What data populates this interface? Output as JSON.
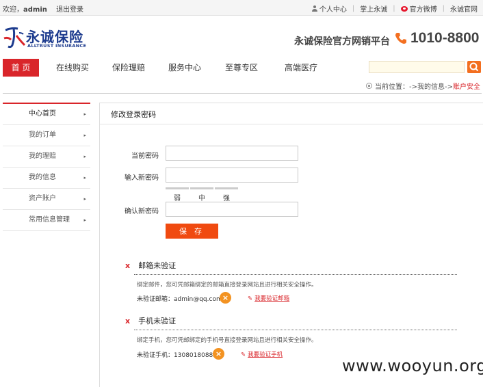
{
  "topbar": {
    "welcome": "欢迎，",
    "username": "admin",
    "logout": "退出登录",
    "links": [
      "个人中心",
      "掌上永诚",
      "官方微博",
      "永诚官网"
    ]
  },
  "header": {
    "logo_cn": "永诚保险",
    "logo_en": "ALLTRUST INSURANCE",
    "slogan": "永诚保险官方网销平台",
    "hotline": "1010-8800"
  },
  "nav": {
    "items": [
      "首 页",
      "在线购买",
      "保险理赔",
      "服务中心",
      "至尊专区",
      "高端医疗"
    ],
    "active": 0,
    "search_placeholder": ""
  },
  "breadcrumb": {
    "prefix": "当前位置：->我的信息->",
    "current": "账户安全"
  },
  "sidebar": {
    "items": [
      "中心首页",
      "我的订单",
      "我的理赔",
      "我的信息",
      "资产账户",
      "常用信息管理"
    ]
  },
  "form": {
    "title": "修改登录密码",
    "current_label": "当前密码",
    "new_label": "输入新密码",
    "confirm_label": "确认新密码",
    "strength_labels": [
      "弱",
      "中",
      "强"
    ],
    "save_label": "保 存"
  },
  "email_verify": {
    "mark": "x",
    "title": "邮箱未验证",
    "desc": "绑定邮件，您可凭邮箱绑定的邮箱直接登录网站且进行相关安全操作。",
    "row_label": "未验证邮箱：",
    "value": "admin@qq.com",
    "link": "我要验证邮箱"
  },
  "phone_verify": {
    "mark": "x",
    "title": "手机未验证",
    "desc": "绑定手机，您可凭邮绑定的手机号直接登录网站且进行相关安全操作。",
    "row_label": "未验证手机：",
    "value": "13080180882",
    "link": "我要验证手机"
  },
  "watermark": "www.wooyun.org",
  "colors": {
    "brand_red": "#d9252a",
    "button_orange": "#f04a10",
    "badge_orange": "#f39322",
    "logo_blue": "#1d3b8e"
  }
}
